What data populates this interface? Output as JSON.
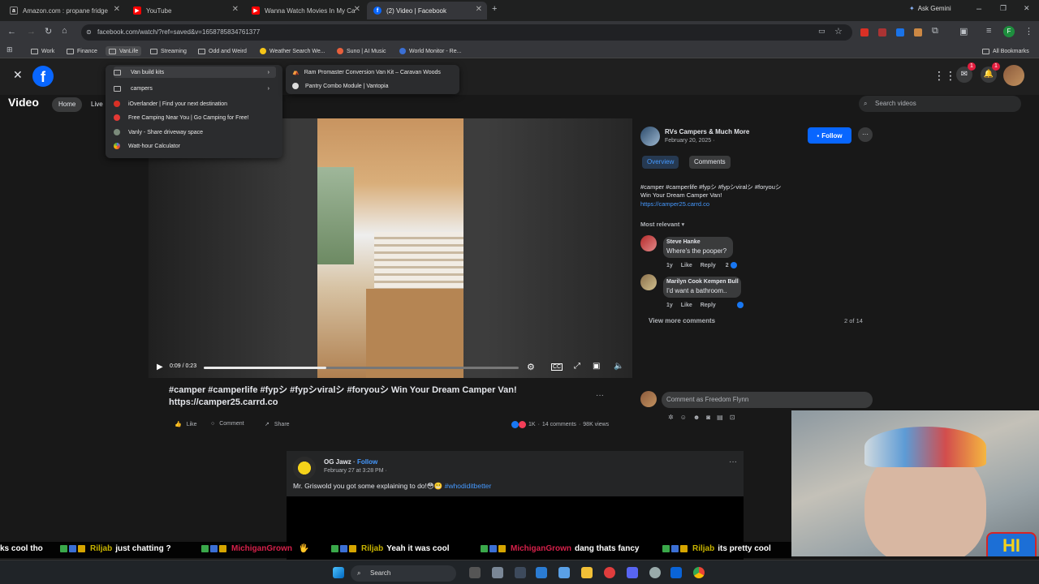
{
  "browser": {
    "tabs": [
      {
        "title": "Amazon.com : propane fridge",
        "favicon": "a"
      },
      {
        "title": "YouTube",
        "favicon": "yt"
      },
      {
        "title": "Wanna Watch Movies In My Ca",
        "favicon": "yt"
      },
      {
        "title": "(2) Video | Facebook",
        "favicon": "fb"
      }
    ],
    "ask_gemini": "Ask Gemini",
    "url": "facebook.com/watch/?ref=saved&v=1658785834761377",
    "bookmarks": [
      "Work",
      "Finance",
      "VanLife",
      "Streaming",
      "Odd and Weird",
      "Weather Search We...",
      "Suno | AI Music",
      "World Monitor - Re..."
    ],
    "all_bookmarks": "All Bookmarks",
    "vanlife_menu": [
      "Van build kits",
      "campers",
      "iOverlander | Find your next destination",
      "Free Camping Near You | Go Camping for Free!",
      "Vanly - Share driveway space",
      "Watt-hour Calculator"
    ],
    "vanbuild_submenu": [
      "Ram Promaster Conversion Van Kit – Caravan Woods",
      "Pantry Combo Module | Vantopia"
    ]
  },
  "facebook": {
    "section_title": "Video",
    "nav_pills": [
      "Home",
      "Live"
    ],
    "search_placeholder": "Search videos",
    "notif_count": "1",
    "messenger_count": "1",
    "player": {
      "time": "0:09 / 0:23",
      "progress": 0.39
    },
    "video_title": "#camper #camperlife #fypシ #fypシviralシ #foryouシ Win Your Dream Camper Van! https://camper25.carrd.co",
    "actions": {
      "like": "Like",
      "comment": "Comment",
      "share": "Share",
      "reactions": "1K",
      "comments": "14 comments",
      "views": "98K views"
    },
    "page": {
      "name": "RVs Campers & Much More",
      "date": "February 20, 2025 ·",
      "follow": "Follow"
    },
    "tabs": [
      "Overview",
      "Comments"
    ],
    "description": "#camper #camperlife #fypシ #fypシviralシ #foryouシ",
    "description_line2": "Win Your Dream Camper Van!",
    "description_link": "https://camper25.carrd.co",
    "sort": "Most relevant",
    "comments": [
      {
        "author": "Steve Hanke",
        "text": "Where's the pooper?",
        "age": "1y",
        "like": "Like",
        "reply": "Reply",
        "reacts": "2"
      },
      {
        "author": "Marilyn Cook Kempen Bull",
        "text": "I'd want a bathroom..",
        "age": "1y",
        "like": "Like",
        "reply": "Reply",
        "reacts": ""
      }
    ],
    "view_more": "View more comments",
    "comment_counter": "2 of 14",
    "comment_as": "Comment as Freedom Flynn",
    "post2": {
      "author": "OG Jawz",
      "follow": "Follow",
      "date": "February 27 at 3:28 PM ·",
      "text": "Mr. Griswold you got some explaining to do!",
      "hashtag": "#whodiditbetter"
    }
  },
  "chat": [
    {
      "user": "",
      "text": "ks cool tho",
      "color": "#ffffff"
    },
    {
      "user": "Riljab",
      "text": "just chatting ?",
      "color": "#c8b400"
    },
    {
      "user": "MichiganGrown",
      "text": "",
      "color": "#d6204a"
    },
    {
      "user": "Riljab",
      "text": "Yeah it was cool",
      "color": "#c8b400"
    },
    {
      "user": "MichiganGrown",
      "text": "dang thats fancy",
      "color": "#d6204a"
    },
    {
      "user": "Riljab",
      "text": "its pretty cool",
      "color": "#c8b400"
    }
  ],
  "taskbar": {
    "search": "Search"
  },
  "colors": {
    "fb_blue": "#0866ff",
    "accent_link": "#4599ff",
    "background": "#181818"
  }
}
